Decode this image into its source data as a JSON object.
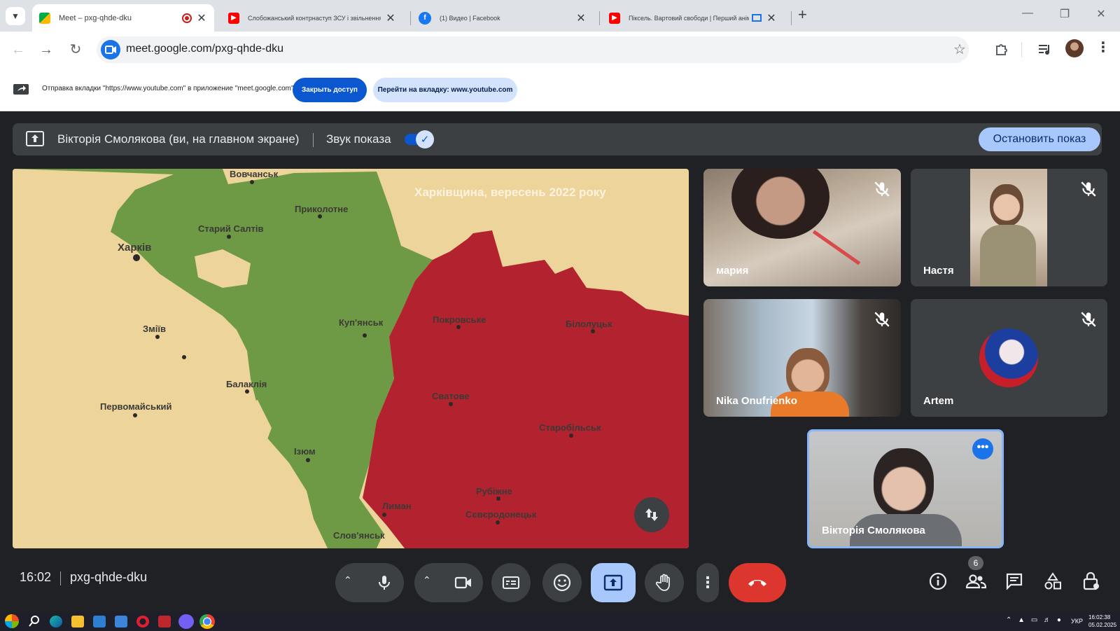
{
  "browser": {
    "tabs": [
      {
        "title": "Meet – pxg-qhde-dku",
        "active": true
      },
      {
        "title": "Слобожанський контрнаступ ЗСУ і звільнення Куп'янська",
        "active": false
      },
      {
        "title": "(1) Видео | Facebook",
        "active": false
      },
      {
        "title": "Піксель. Вартовий свободи | Перший анімований",
        "active": false
      }
    ],
    "url": "meet.google.com/pxg-qhde-dku"
  },
  "infobar": {
    "text": "Отправка вкладки \"https://www.youtube.com\" в приложение \"meet.google.com\"...",
    "stop_label": "Закрыть доступ",
    "switch_label": "Перейти на вкладку: www.youtube.com"
  },
  "presentation": {
    "label": "Вікторія Смолякова (ви, на главном экране)",
    "sound_label": "Звук показа",
    "sound_on": true,
    "stop_label": "Остановить показ"
  },
  "map": {
    "title": "Харківщина, вересень 2022 року",
    "cities": [
      "Вовчанськ",
      "Приколотне",
      "Старий Салтів",
      "Харків",
      "Куп'янськ",
      "Покровське",
      "Білолуцьк",
      "Зміїв",
      "Балаклія",
      "Сватове",
      "Первомайський",
      "Старобільськ",
      "Ізюм",
      "Рубіжне",
      "Лиман",
      "Сєвєродонецьк",
      "Слов'янськ"
    ],
    "colors": {
      "liberated": "#6e9a45",
      "occupied": "#b3222f",
      "land": "#ecd49b"
    }
  },
  "participants": [
    {
      "name": "мария",
      "muted": true
    },
    {
      "name": "Настя",
      "muted": true
    },
    {
      "name": "Nika Onufrienko",
      "muted": true
    },
    {
      "name": "Artem",
      "muted": true
    },
    {
      "name": "Вікторія Смолякова",
      "muted": false
    }
  ],
  "bottom": {
    "time": "16:02",
    "meeting_code": "pxg-qhde-dku",
    "participants_count": "6"
  },
  "taskbar": {
    "lang": "УКР",
    "clock": "16:02:38",
    "date": "05.02.2025"
  }
}
